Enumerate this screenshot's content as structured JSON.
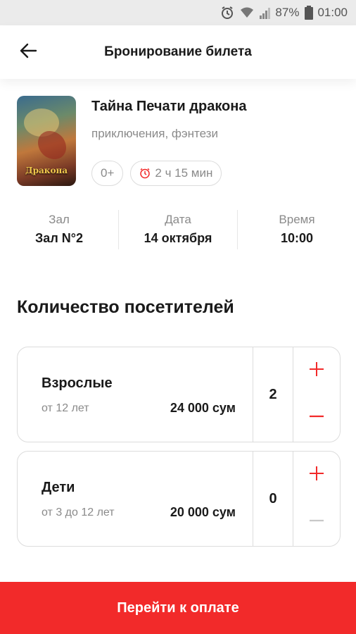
{
  "status_bar": {
    "battery_percent": "87%",
    "time": "01:00"
  },
  "header": {
    "title": "Бронирование билета"
  },
  "movie": {
    "poster_text": "Дракона",
    "title": "Тайна Печати дракона",
    "genre": "приключения, фэнтези",
    "age_rating": "0+",
    "duration": "2 ч 15 мин"
  },
  "info": [
    {
      "label": "Зал",
      "value": "Зал N°2"
    },
    {
      "label": "Дата",
      "value": "14 октября"
    },
    {
      "label": "Время",
      "value": "10:00"
    }
  ],
  "visitors": {
    "title": "Количество посетителей",
    "tickets": [
      {
        "name": "Взрослые",
        "age": "от 12 лет",
        "price": "24 000 сум",
        "count": "2",
        "minus_enabled": true
      },
      {
        "name": "Дети",
        "age": "от 3 до 12 лет",
        "price": "20 000 сум",
        "count": "0",
        "minus_enabled": false
      }
    ]
  },
  "footer": {
    "pay_label": "Перейти к оплате"
  },
  "colors": {
    "accent": "#f22a2a",
    "disabled": "#c8c8c8"
  }
}
